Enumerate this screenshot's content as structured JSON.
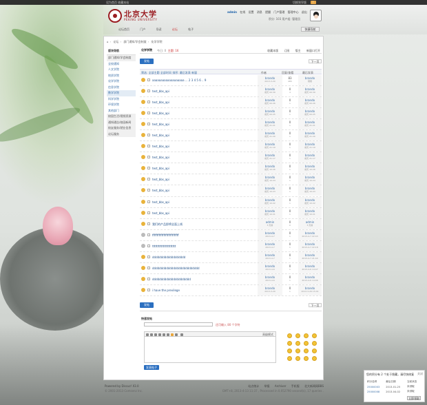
{
  "topbar": {
    "left": "设为首页  收藏本站",
    "right": "切换到窄版",
    "warning": "!"
  },
  "logo": {
    "cn": "北京大学",
    "en": "PEKING UNIVERSITY"
  },
  "user": {
    "name": "admin",
    "items": [
      "在线",
      "设置",
      "消息",
      "提醒",
      "门户管理",
      "管理中心",
      "退出"
    ],
    "line2": "积分: 103  用户组: 管理员"
  },
  "mainnav": {
    "items": [
      "论坛首页",
      "门户",
      "导读",
      "论坛",
      "帖子"
    ],
    "active": 3
  },
  "quick_button": "快捷导航",
  "breadcrumb": [
    "首页",
    "论坛",
    "部门通知/学会制度",
    "化学学院"
  ],
  "sidebar": {
    "header": "版块导航",
    "items": [
      "部门通知/学会制度",
      "全校通知",
      "人文学院",
      "地质学院",
      "化学学院",
      "信息学院",
      "数学学院",
      "科学学院",
      "环境学院",
      "其他部门",
      "校园生活/视频资源",
      "通知通告/校园新闻",
      "校友服务/就业信息",
      "论坛服务"
    ],
    "active": 6
  },
  "forum": {
    "name": "化学学院",
    "today_label": "今日: 0",
    "topics_label": "主题: 16",
    "actions": [
      "收藏本版",
      "订阅",
      "版主",
      "新窗口打开"
    ]
  },
  "post_button": "发帖",
  "pager_label": "下一页",
  "filters": {
    "items": [
      "筛选:",
      "全部主题",
      "全部时间",
      "排序:",
      "最后发表",
      "新窗"
    ],
    "cols": [
      "作者",
      "回复/查看",
      "最后发表"
    ]
  },
  "threads": [
    {
      "title": "aaaaaaaaaaaaaaaaaaa ... 2 3 4 5 6 .. 9",
      "author": "brando",
      "adate": "2013-3-20",
      "replies": "83",
      "views": "485",
      "last": "brando",
      "ldate": "刚刚"
    },
    {
      "title": "test_bbs_api",
      "author": "brando",
      "adate": "前天 00:39",
      "replies": "0",
      "views": "4",
      "last": "brando",
      "ldate": "前天 00:39"
    },
    {
      "title": "test_bbs_api",
      "author": "brando",
      "adate": "前天 00:26",
      "replies": "0",
      "views": "1",
      "last": "brando",
      "ldate": "前天 00:26"
    },
    {
      "title": "test_bbs_api",
      "author": "brando",
      "adate": "前天 00:25",
      "replies": "0",
      "views": "1",
      "last": "brando",
      "ldate": "前天 00:25"
    },
    {
      "title": "test_bbs_api",
      "author": "brando",
      "adate": "前天 21:21",
      "replies": "0",
      "views": "1",
      "last": "brando",
      "ldate": "前天 21:21"
    },
    {
      "title": "test_bbs_api",
      "author": "brando",
      "adate": "前天 21:20",
      "replies": "0",
      "views": "1",
      "last": "brando",
      "ldate": "前天 21:20"
    },
    {
      "title": "test_bbs_api",
      "author": "brando",
      "adate": "前天 21:19",
      "replies": "0",
      "views": "1",
      "last": "brando",
      "ldate": "前天 21:19"
    },
    {
      "title": "test_bbs_api",
      "author": "brando",
      "adate": "前天 21:17",
      "replies": "0",
      "views": "1",
      "last": "brando",
      "ldate": "前天 21:17"
    },
    {
      "title": "test_bbs_api",
      "author": "brando",
      "adate": "前天 10:26",
      "replies": "0",
      "views": "1",
      "last": "brando",
      "ldate": "前天 10:26"
    },
    {
      "title": "test_bbs_api",
      "author": "brando",
      "adate": "前天 10:24",
      "replies": "0",
      "views": "1",
      "last": "brando",
      "ldate": "前天 10:24"
    },
    {
      "title": "test_bbs_api",
      "author": "brando",
      "adate": "前天 10:23",
      "replies": "0",
      "views": "1",
      "last": "brando",
      "ldate": "前天 10:23"
    },
    {
      "title": "test_bbs_api",
      "author": "brando",
      "adate": "前天 10:22",
      "replies": "0",
      "views": "1",
      "last": "brando",
      "ldate": "前天 10:22"
    },
    {
      "title": "test_bbs_api",
      "author": "brando",
      "adate": "前天 10:21",
      "replies": "0",
      "views": "1",
      "last": "brando",
      "ldate": "前天 10:21"
    },
    {
      "title": "我们的产品即将全面上线",
      "author": "admin",
      "adate": "5 天前",
      "replies": "0",
      "views": "0",
      "last": "admin",
      "ldate": "5 天前"
    },
    {
      "title": "ffffffffffffffffffffffffffff",
      "author": "brando",
      "adate": "2013-4-7",
      "replies": "0",
      "views": "1",
      "last": "brando",
      "ldate": "2013-4-7 22:43"
    },
    {
      "title": "tttttttttttttttttttttt",
      "author": "brando",
      "adate": "2013-4-7",
      "replies": "0",
      "views": "1",
      "last": "brando",
      "ldate": "2013-4-7 22:18"
    },
    {
      "title": "ddddddddddddddddddd",
      "author": "brando",
      "adate": "2013-4-7",
      "replies": "0",
      "views": "1",
      "last": "brando",
      "ldate": "2013-4-7 21:44"
    },
    {
      "title": "ddddddddddddddddddddddddddd",
      "author": "brando",
      "adate": "2013-4-6",
      "replies": "0",
      "views": "1",
      "last": "brando",
      "ldate": "2013-4-6 14:47"
    },
    {
      "title": "dddddddddddddddddddddd",
      "author": "brando",
      "adate": "2013-4-6",
      "replies": "0",
      "views": "1",
      "last": "brando",
      "ldate": "2013-4-6 14:46"
    },
    {
      "title": "i have the previlege",
      "author": "brando",
      "adate": "2013-3-29",
      "replies": "0",
      "views": "1",
      "last": "brando",
      "ldate": "2013-3-29 15:41"
    }
  ],
  "quick_reply": {
    "header": "快速发帖",
    "subject_msg": "还可输入 80 个字符",
    "advanced": "高级模式",
    "submit": "发表帖子"
  },
  "footer": {
    "powered": "Powered by Discuz! X3.0",
    "copyright": "© 2001-2013 Comsenz Inc.",
    "links": [
      "站点统计",
      "举报",
      "Archiver",
      "手机版",
      "北大新闻网BBS"
    ],
    "gmt": "GMT+8, 2013-4-13 11:37 , Processed in 0.052790 second(s), 17 queries ."
  },
  "popup": {
    "title": "您的积分有 2 个处于隐藏，请尽快修复",
    "close": "关闭",
    "headers": [
      "积分名称",
      "最后日期",
      "当前状态"
    ],
    "rows": [
      [
        "25000003",
        "2013-01-25",
        "未领取"
      ],
      [
        "25000008",
        "2013-04-02",
        "未领取"
      ]
    ],
    "button": "立即领取"
  }
}
